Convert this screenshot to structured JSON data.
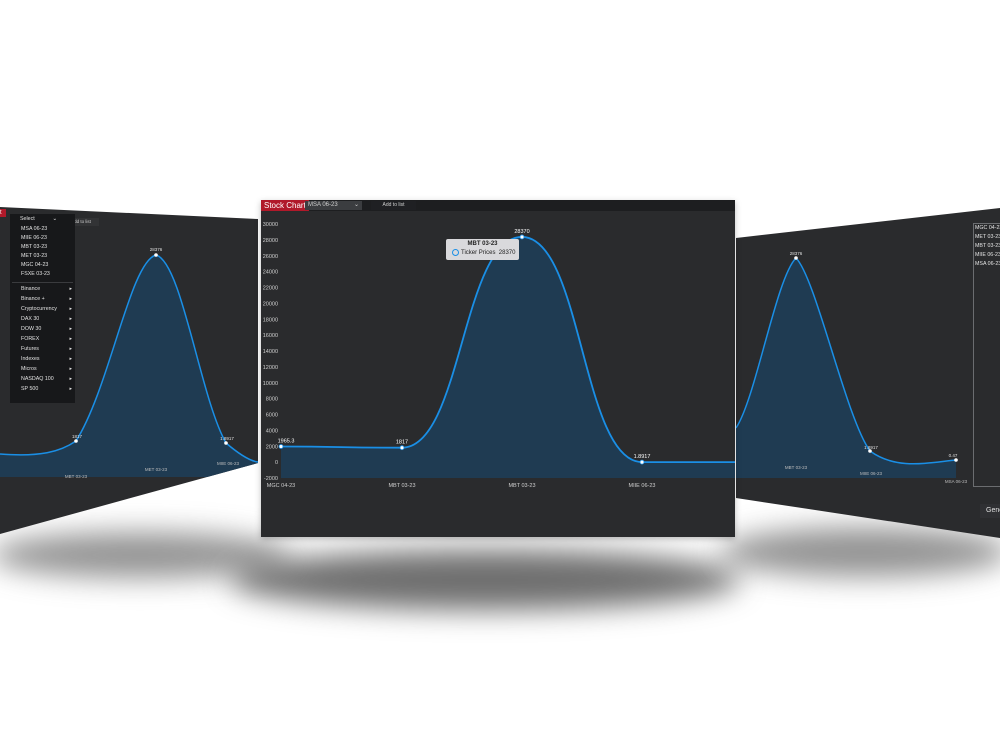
{
  "app": {
    "title": "Stock Chart"
  },
  "toolbar": {
    "ticker_selected": "MSA 06-23",
    "add_label": "Add to list"
  },
  "left_panel": {
    "brand_fragment": "t",
    "select_label": "Select",
    "add_label": "Add to list",
    "menu_items": [
      "MSA 06-23",
      "MIIE 06-23",
      "MBT 03-23",
      "MET 03-23",
      "MGC 04-23",
      "FSXE 03-23"
    ],
    "categories": [
      "Binance",
      "Binance +",
      "Cryptocurrency",
      "DAX 30",
      "DOW 30",
      "FOREX",
      "Futures",
      "Indexes",
      "Micros",
      "NASDAQ 100",
      "SP 500"
    ],
    "point_labels": [
      "1817",
      "28376",
      "1.8917"
    ],
    "x_labels": [
      "MBT 03-23",
      "MET 03-23",
      "MIIE 06-23"
    ]
  },
  "right_panel": {
    "list_items": [
      "MGC 04-23",
      "MET 03-23",
      "MBT 03-23",
      "MIIE 06-23",
      "MSA 06-23"
    ],
    "generate_label": "Gene",
    "point_labels": [
      "28376",
      "1.8917",
      "0.47"
    ],
    "x_labels": [
      "MBT 03-23",
      "MIIE 06-23",
      "MSA 06-23"
    ]
  },
  "tooltip": {
    "title": "MBT 03-23",
    "series_label": "Ticker Prices",
    "value": "28370"
  },
  "colors": {
    "accent": "#b0192a",
    "line": "#1a8fe6",
    "fill": "#1f3b52",
    "background": "#2a2b2d"
  },
  "chart_data": {
    "type": "area",
    "categories": [
      "MGC 04-23",
      "MBT 03-23",
      "MBT 03-23",
      "MIIE 06-23",
      "MSA 06-23"
    ],
    "values": [
      1965.3,
      1817,
      28370,
      1.8917,
      0.47
    ],
    "point_labels": [
      "1965.3",
      "1817",
      "28370",
      "1.8917",
      ""
    ],
    "x_tick_labels": [
      "MGC 04-23",
      "MBT 03-23",
      "MBT 03-23",
      "MIIE 06-23"
    ],
    "y_ticks": [
      -2000,
      0,
      2000,
      4000,
      6000,
      8000,
      10000,
      12000,
      14000,
      16000,
      18000,
      20000,
      22000,
      24000,
      26000,
      28000,
      30000
    ],
    "ylim": [
      -2000,
      30000
    ],
    "grid": false,
    "legend": "none"
  }
}
